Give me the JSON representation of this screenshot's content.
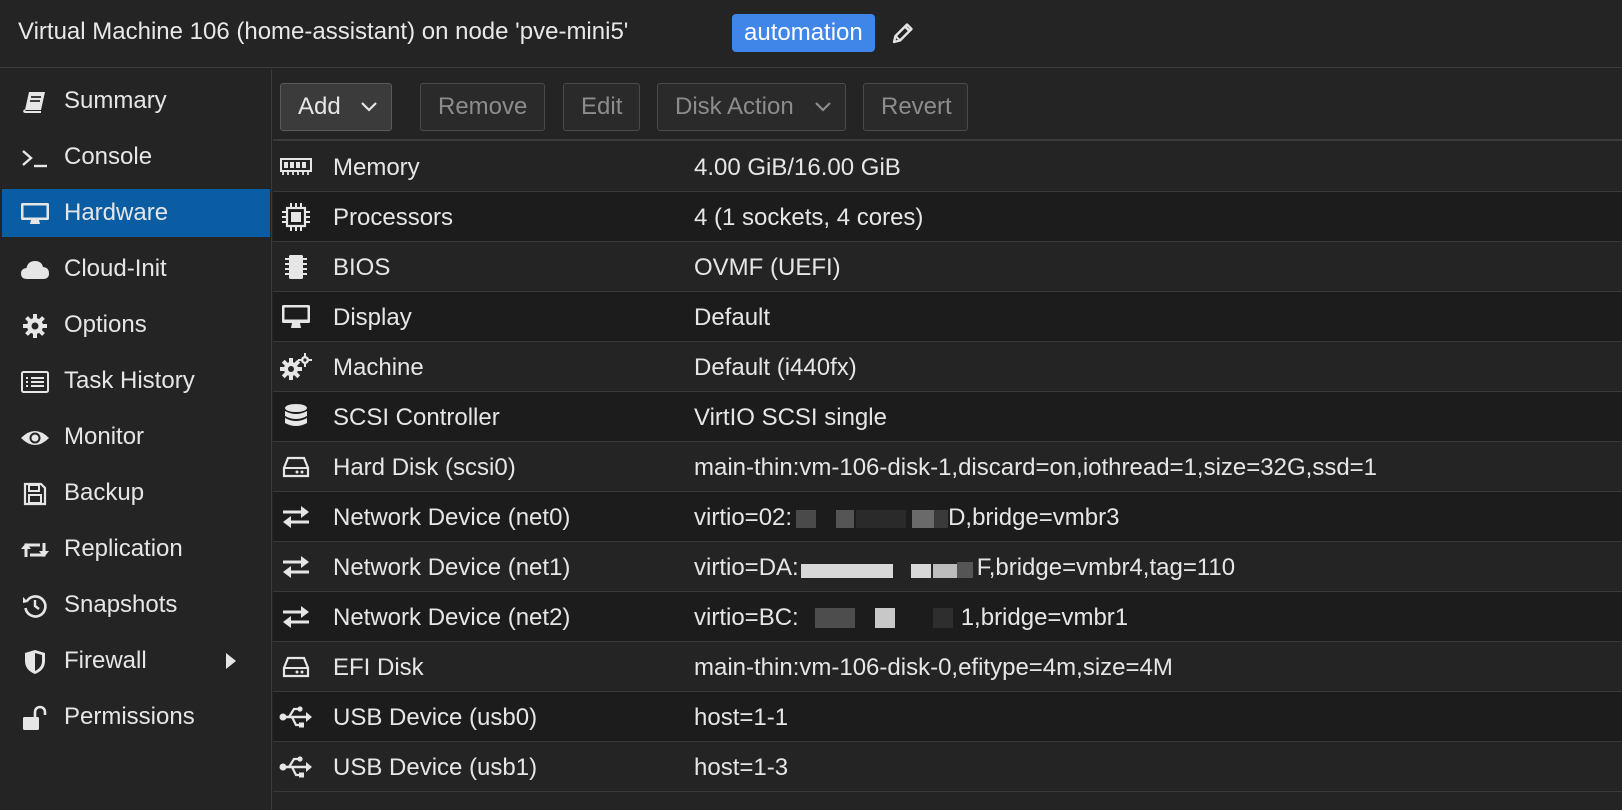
{
  "header": {
    "title": "Virtual Machine 106 (home-assistant) on node 'pve-mini5'",
    "tag": "automation",
    "edit_icon": "pencil-icon"
  },
  "sidebar": {
    "items": [
      {
        "label": "Summary",
        "icon": "book-icon",
        "active": false
      },
      {
        "label": "Console",
        "icon": "terminal-icon",
        "active": false
      },
      {
        "label": "Hardware",
        "icon": "monitor-icon",
        "active": true
      },
      {
        "label": "Cloud-Init",
        "icon": "cloud-icon",
        "active": false
      },
      {
        "label": "Options",
        "icon": "gear-icon",
        "active": false
      },
      {
        "label": "Task History",
        "icon": "list-icon",
        "active": false
      },
      {
        "label": "Monitor",
        "icon": "eye-icon",
        "active": false
      },
      {
        "label": "Backup",
        "icon": "floppy-icon",
        "active": false
      },
      {
        "label": "Replication",
        "icon": "retweet-icon",
        "active": false
      },
      {
        "label": "Snapshots",
        "icon": "history-icon",
        "active": false
      },
      {
        "label": "Firewall",
        "icon": "shield-icon",
        "active": false,
        "expandable": true
      },
      {
        "label": "Permissions",
        "icon": "unlock-icon",
        "active": false
      }
    ]
  },
  "toolbar": {
    "add": "Add",
    "remove": "Remove",
    "edit": "Edit",
    "disk_action": "Disk Action",
    "revert": "Revert"
  },
  "hardware": {
    "rows": [
      {
        "name": "Memory",
        "value": "4.00 GiB/16.00 GiB",
        "icon": "memory-icon"
      },
      {
        "name": "Processors",
        "value": "4 (1 sockets, 4 cores)",
        "icon": "cpu-icon"
      },
      {
        "name": "BIOS",
        "value": "OVMF (UEFI)",
        "icon": "chip-icon"
      },
      {
        "name": "Display",
        "value": "Default",
        "icon": "desktop-icon"
      },
      {
        "name": "Machine",
        "value": "Default (i440fx)",
        "icon": "cogs-icon"
      },
      {
        "name": "SCSI Controller",
        "value": "VirtIO SCSI single",
        "icon": "database-icon"
      },
      {
        "name": "Hard Disk (scsi0)",
        "value": "main-thin:vm-106-disk-1,discard=on,iothread=1,size=32G,ssd=1",
        "icon": "hdd-icon"
      },
      {
        "name": "Network Device (net0)",
        "value_prefix": "virtio=02:",
        "value_suffix": "D,bridge=vmbr3",
        "icon": "exchange-icon"
      },
      {
        "name": "Network Device (net1)",
        "value_prefix": "virtio=DA:",
        "value_suffix": "F,bridge=vmbr4,tag=110",
        "icon": "exchange-icon"
      },
      {
        "name": "Network Device (net2)",
        "value_prefix": "virtio=BC:",
        "value_suffix": "1,bridge=vmbr1",
        "icon": "exchange-icon"
      },
      {
        "name": "EFI Disk",
        "value": "main-thin:vm-106-disk-0,efitype=4m,size=4M",
        "icon": "hdd-icon"
      },
      {
        "name": "USB Device (usb0)",
        "value": "host=1-1",
        "icon": "usb-icon"
      },
      {
        "name": "USB Device (usb1)",
        "value": "host=1-3",
        "icon": "usb-icon"
      }
    ]
  },
  "colors": {
    "accent": "#0a5ca3",
    "tag": "#3f86e8",
    "background": "#242424"
  }
}
